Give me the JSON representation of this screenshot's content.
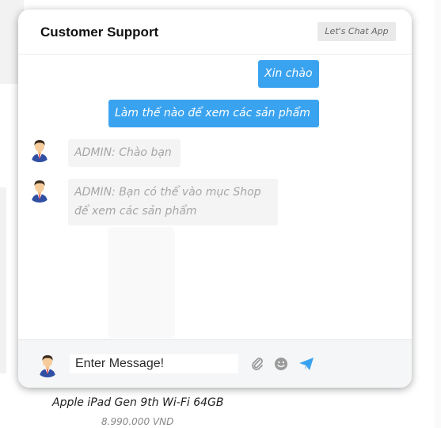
{
  "header": {
    "title": "Customer Support",
    "app_badge": "Let's Chat App"
  },
  "messages": [
    {
      "sender": "user",
      "text": "Xin chào"
    },
    {
      "sender": "user",
      "text": "Làm thế nào để xem các sản phẩm"
    },
    {
      "sender": "admin",
      "text": "ADMIN: Chào bạn"
    },
    {
      "sender": "admin",
      "text": "ADMIN: Bạn có thể vào mục Shop để xem các sản phẩm"
    }
  ],
  "composer": {
    "placeholder": "Enter Message!",
    "icons": [
      "avatar-icon",
      "paperclip-icon",
      "emoji-icon",
      "send-icon"
    ]
  },
  "background_product": {
    "name": "Apple iPad Gen 9th Wi-Fi 64GB",
    "price": "8.990.000 VND"
  },
  "colors": {
    "user_bubble": "#3aa3f0",
    "admin_bubble": "#f4f4f5",
    "send_icon": "#3aa3f0"
  }
}
